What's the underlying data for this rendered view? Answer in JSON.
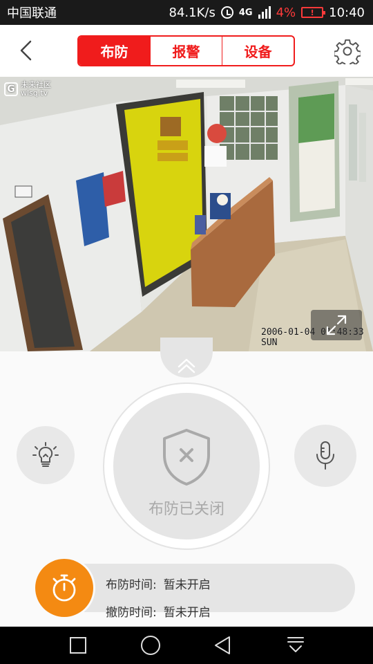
{
  "status_bar": {
    "carrier": "中国联通",
    "speed": "84.1K/s",
    "network": "4G",
    "battery_percent": "4%",
    "battery_icon_text": "!",
    "time": "10:40",
    "icons": [
      "alarm-icon",
      "signal-icon",
      "battery-low-icon"
    ]
  },
  "header": {
    "tabs": [
      {
        "label": "布防",
        "active": true
      },
      {
        "label": "报警",
        "active": false
      },
      {
        "label": "设备",
        "active": false
      }
    ],
    "accent_color": "#f01c1c",
    "icons": [
      "back-icon",
      "settings-icon"
    ]
  },
  "video": {
    "watermark_line1": "未来社区",
    "watermark_line2": "wlsq.tv",
    "timestamp": "2006-01-04 01:48:33 SUN",
    "icons": [
      "fullscreen-icon"
    ]
  },
  "control": {
    "arm_status_label": "布防已关闭",
    "schedule": {
      "arm_label": "布防时间:",
      "arm_value": "暂未开启",
      "disarm_label": "撤防时间:",
      "disarm_value": "暂未开启"
    },
    "timer_color": "#f48a12",
    "icons": [
      "chevron-up-icon",
      "shield-x-icon",
      "lightbulb-icon",
      "microphone-icon",
      "timer-icon"
    ]
  },
  "navbar": {
    "icons": [
      "recent-apps-icon",
      "home-icon",
      "back-nav-icon",
      "notification-pull-icon"
    ]
  }
}
